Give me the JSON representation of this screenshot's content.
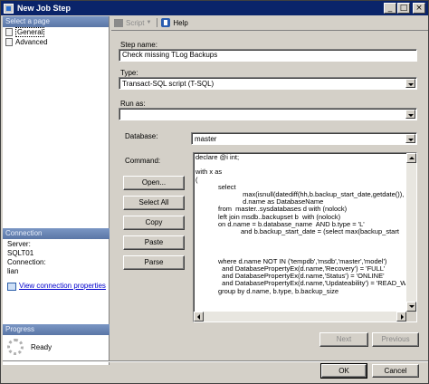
{
  "window": {
    "title": "New Job Step",
    "minimize": "_",
    "maximize": "□",
    "close": "×"
  },
  "left": {
    "select_page_header": "Select a page",
    "pages": [
      {
        "label": "General"
      },
      {
        "label": "Advanced"
      }
    ],
    "connection_header": "Connection",
    "server_label": "Server:",
    "server_value": "SQLT01",
    "connection_label": "Connection:",
    "connection_value": "lian",
    "view_connection_link": "View connection properties",
    "progress_header": "Progress",
    "progress_status": "Ready"
  },
  "toolbar": {
    "script_label": "Script",
    "script_arrow": "▼",
    "help_label": "Help"
  },
  "form": {
    "step_name_label": "Step name:",
    "step_name_value": "Check missing TLog Backups",
    "type_label": "Type:",
    "type_value": "Transact-SQL script (T-SQL)",
    "run_as_label": "Run as:",
    "run_as_value": "",
    "database_label": "Database:",
    "database_value": "master",
    "command_label": "Command:",
    "command_lines": [
      "declare @i int;",
      "",
      "with x as",
      "(",
      "            select",
      "                         max(isnull(datediff(hh,b.backup_start_date,getdate()),",
      "                         d.name as DatabaseName",
      "            from  master..sysdatabases d with (nolock)",
      "            left join msdb..backupset b  with (nolock)",
      "            on d.name = b.database_name  AND b.type = 'L'",
      "                        and b.backup_start_date = (select max(backup_start",
      "",
      "",
      "",
      "            where d.name NOT IN ('tempdb','msdb','master','model')",
      "              and DatabasePropertyEx(d.name,'Recovery') = 'FULL'",
      "              and DatabasePropertyEx(d.name,'Status') = 'ONLINE'",
      "              and DatabasePropertyEx(d.name,'Updateability') = 'READ_WF",
      "            group by d.name, b.type, b.backup_size"
    ]
  },
  "buttons": {
    "open": "Open...",
    "select_all": "Select All",
    "copy": "Copy",
    "paste": "Paste",
    "parse": "Parse",
    "next": "Next",
    "previous": "Previous",
    "ok": "OK",
    "cancel": "Cancel"
  }
}
